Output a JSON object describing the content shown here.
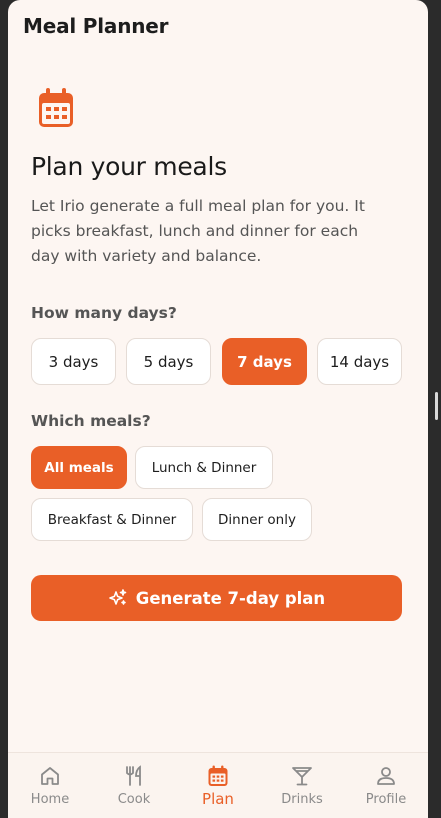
{
  "app": {
    "title": "Meal Planner"
  },
  "hero": {
    "icon": "calendar-icon",
    "heading": "Plan your meals",
    "description": "Let Irio generate a full meal plan for you. It picks breakfast, lunch and dinner for each day with variety and balance."
  },
  "days": {
    "label": "How many days?",
    "options": [
      "3 days",
      "5 days",
      "7 days",
      "14 days"
    ],
    "selected": "7 days"
  },
  "meals": {
    "label": "Which meals?",
    "options": [
      "All meals",
      "Lunch & Dinner",
      "Breakfast & Dinner",
      "Dinner only"
    ],
    "selected": "All meals"
  },
  "generate_button": {
    "label": "Generate 7-day plan",
    "icon": "sparkles-icon"
  },
  "nav": {
    "items": [
      {
        "label": "Home",
        "icon": "home-icon"
      },
      {
        "label": "Cook",
        "icon": "utensils-icon"
      },
      {
        "label": "Plan",
        "icon": "calendar-icon"
      },
      {
        "label": "Drinks",
        "icon": "cocktail-icon"
      },
      {
        "label": "Profile",
        "icon": "user-icon"
      }
    ],
    "active": "Plan"
  },
  "colors": {
    "accent": "#e95f27",
    "background": "#fdf6f2"
  }
}
